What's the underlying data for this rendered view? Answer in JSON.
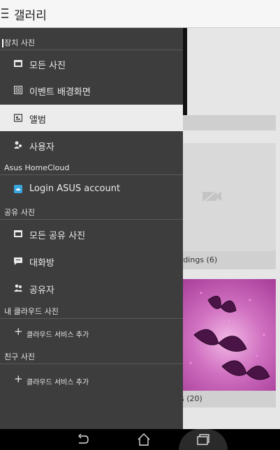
{
  "app": {
    "title": "갤러리"
  },
  "drawer": {
    "sections": [
      {
        "header": "장치 사진",
        "items": [
          {
            "label": "모든 사진",
            "icon": "photos-icon",
            "selected": false
          },
          {
            "label": "이벤트 배경화면",
            "icon": "event-wallpaper-icon",
            "selected": false
          },
          {
            "label": "앨범",
            "icon": "album-icon",
            "selected": true
          },
          {
            "label": "사용자",
            "icon": "people-icon",
            "selected": false
          }
        ]
      },
      {
        "header": "Asus HomeCloud",
        "items": [
          {
            "label": "Login ASUS account",
            "icon": "homecloud-icon",
            "selected": false
          }
        ]
      },
      {
        "header": "공유 사진",
        "items": [
          {
            "label": "모든 공유 사진",
            "icon": "photos-icon",
            "selected": false
          },
          {
            "label": "대화방",
            "icon": "chat-icon",
            "selected": false
          },
          {
            "label": "공유자",
            "icon": "sharers-icon",
            "selected": false
          }
        ]
      },
      {
        "header": "내 클라우드 사진",
        "items": [
          {
            "label": "클라우드 서비스 추가",
            "icon": "plus-icon"
          }
        ]
      },
      {
        "header": "친구 사진",
        "items": [
          {
            "label": "클라우드 서비스 추가",
            "icon": "plus-icon"
          }
        ]
      }
    ]
  },
  "background": {
    "album2_caption": "rdings (6)",
    "album3_caption": "s (20)"
  },
  "navbar": {
    "back": "back-icon",
    "home": "home-icon",
    "recents": "recents-icon"
  }
}
